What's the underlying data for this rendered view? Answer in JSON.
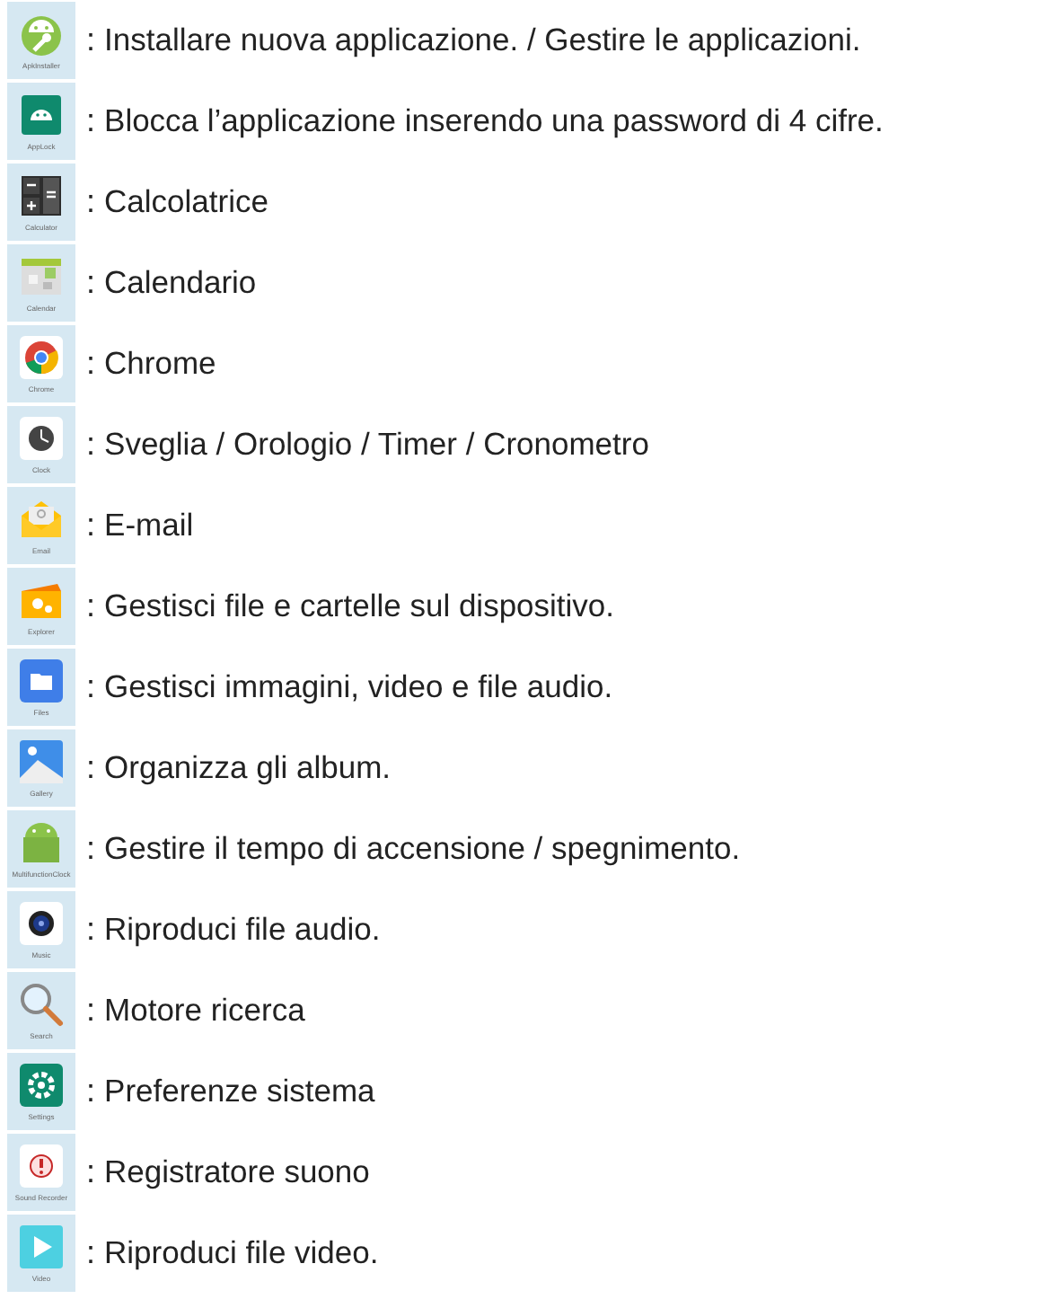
{
  "apps": [
    {
      "kind": "apk-installer",
      "label": "ApkInstaller",
      "separator": ":",
      "description": "Installare nuova applicazione. / Gestire le applicazioni."
    },
    {
      "kind": "app-lock",
      "label": "AppLock",
      "separator": ":",
      "description": "Blocca l’applicazione inserendo una password di 4 cifre."
    },
    {
      "kind": "calculator",
      "label": "Calculator",
      "separator": ":",
      "description": "Calcolatrice"
    },
    {
      "kind": "calendar",
      "label": "Calendar",
      "separator": ":",
      "description": "Calendario"
    },
    {
      "kind": "chrome",
      "label": "Chrome",
      "separator": ":",
      "description": "Chrome"
    },
    {
      "kind": "clock",
      "label": "Clock",
      "separator": ":",
      "description": "Sveglia / Orologio / Timer / Cronometro"
    },
    {
      "kind": "email",
      "label": "Email",
      "separator": ":",
      "description": "E-mail"
    },
    {
      "kind": "explorer",
      "label": "Explorer",
      "separator": ":",
      "description": "Gestisci file e cartelle sul dispositivo."
    },
    {
      "kind": "files",
      "label": "Files",
      "separator": ":",
      "description": "Gestisci immagini, video e file audio."
    },
    {
      "kind": "gallery",
      "label": "Gallery",
      "separator": ":",
      "description": "Organizza gli album."
    },
    {
      "kind": "android",
      "label": "MultifunctionClock",
      "separator": ":",
      "description": "Gestire il tempo di accensione / spegnimento."
    },
    {
      "kind": "music",
      "label": "Music",
      "separator": ":",
      "description": "Riproduci file audio."
    },
    {
      "kind": "search",
      "label": "Search",
      "separator": ":",
      "description": "Motore ricerca"
    },
    {
      "kind": "settings",
      "label": "Settings",
      "separator": ":",
      "description": "Preferenze sistema"
    },
    {
      "kind": "recorder",
      "label": "Sound Recorder",
      "separator": ":",
      "description": "Registratore suono"
    },
    {
      "kind": "video",
      "label": "Video",
      "separator": ":",
      "description": "Riproduci file video."
    }
  ]
}
